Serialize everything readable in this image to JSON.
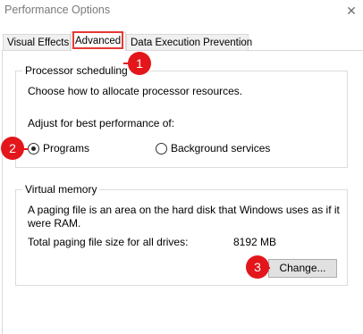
{
  "window": {
    "title": "Performance Options",
    "close_glyph": "✕"
  },
  "tabs": [
    {
      "label": "Visual Effects",
      "active": false
    },
    {
      "label": "Advanced",
      "active": true
    },
    {
      "label": "Data Execution Prevention",
      "active": false
    }
  ],
  "processor_scheduling": {
    "legend": "Processor scheduling",
    "description": "Choose how to allocate processor resources.",
    "adjust_label": "Adjust for best performance of:",
    "options": [
      {
        "label": "Programs",
        "selected": true
      },
      {
        "label": "Background services",
        "selected": false
      }
    ]
  },
  "virtual_memory": {
    "legend": "Virtual memory",
    "description_line1": "A paging file is an area on the hard disk that Windows uses as if it",
    "description_line2": "were RAM.",
    "total_label": "Total paging file size for all drives:",
    "total_value": "8192 MB",
    "change_button": "Change..."
  },
  "annotations": {
    "badges": [
      "1",
      "2",
      "3"
    ],
    "color": "#e3161b"
  }
}
